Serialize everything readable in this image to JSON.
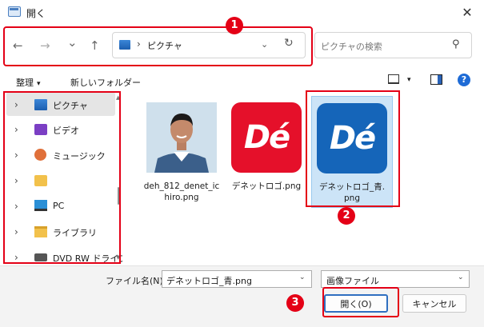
{
  "window": {
    "title": "開く",
    "close_glyph": "✕"
  },
  "nav": {
    "back": "←",
    "forward": "→",
    "recent": "⌄",
    "up": "↑",
    "address_chevron": "›",
    "address_path": "ピクチャ",
    "address_dropdown": "⌄",
    "refresh": "↻",
    "search_placeholder": "ピクチャの検索",
    "search_icon": "⚲"
  },
  "toolbar": {
    "organize": "整理",
    "organize_caret": "▾",
    "new_folder": "新しいフォルダー",
    "view_caret": "▾",
    "help": "?"
  },
  "sidebar": {
    "items": [
      {
        "label": "ピクチャ",
        "icon": "pictures-icon",
        "selected": true
      },
      {
        "label": "ビデオ",
        "icon": "videos-icon"
      },
      {
        "label": "ミュージック",
        "icon": "music-icon"
      },
      {
        "label": "",
        "icon": "folder-icon"
      },
      {
        "label": "PC",
        "icon": "pc-icon"
      },
      {
        "label": "ライブラリ",
        "icon": "library-icon"
      },
      {
        "label": "DVD RW ドライブ",
        "icon": "dvd-drive-icon"
      }
    ],
    "chevron": "›"
  },
  "files": [
    {
      "name": "deh_812_denet_ichiro.png",
      "line1": "deh_812_denet_ic",
      "line2": "hiro.png",
      "thumb": "person-photo"
    },
    {
      "name": "デネットロゴ.png",
      "line1": "デネットロゴ.png",
      "line2": "",
      "thumb": "de-logo-red",
      "logo_text": "Dé"
    },
    {
      "name": "デネットロゴ_青.png",
      "line1": "デネットロゴ_青.",
      "line2": "png",
      "thumb": "de-logo-blue",
      "logo_text": "Dé",
      "selected": true
    }
  ],
  "footer": {
    "filename_label": "ファイル名(N):",
    "filename_value": "デネットロゴ_青.png",
    "filetype_value": "画像ファイル",
    "dropdown_glyph": "⌄",
    "open_button": "開く(O)",
    "cancel_button": "キャンセル"
  },
  "callouts": [
    "1",
    "2",
    "3"
  ],
  "colors": {
    "callout_red": "#e40016",
    "logo_red": "#e5102a",
    "logo_blue": "#1565b9",
    "selection": "#cce4f7",
    "primary_border": "#2f6fc0"
  }
}
